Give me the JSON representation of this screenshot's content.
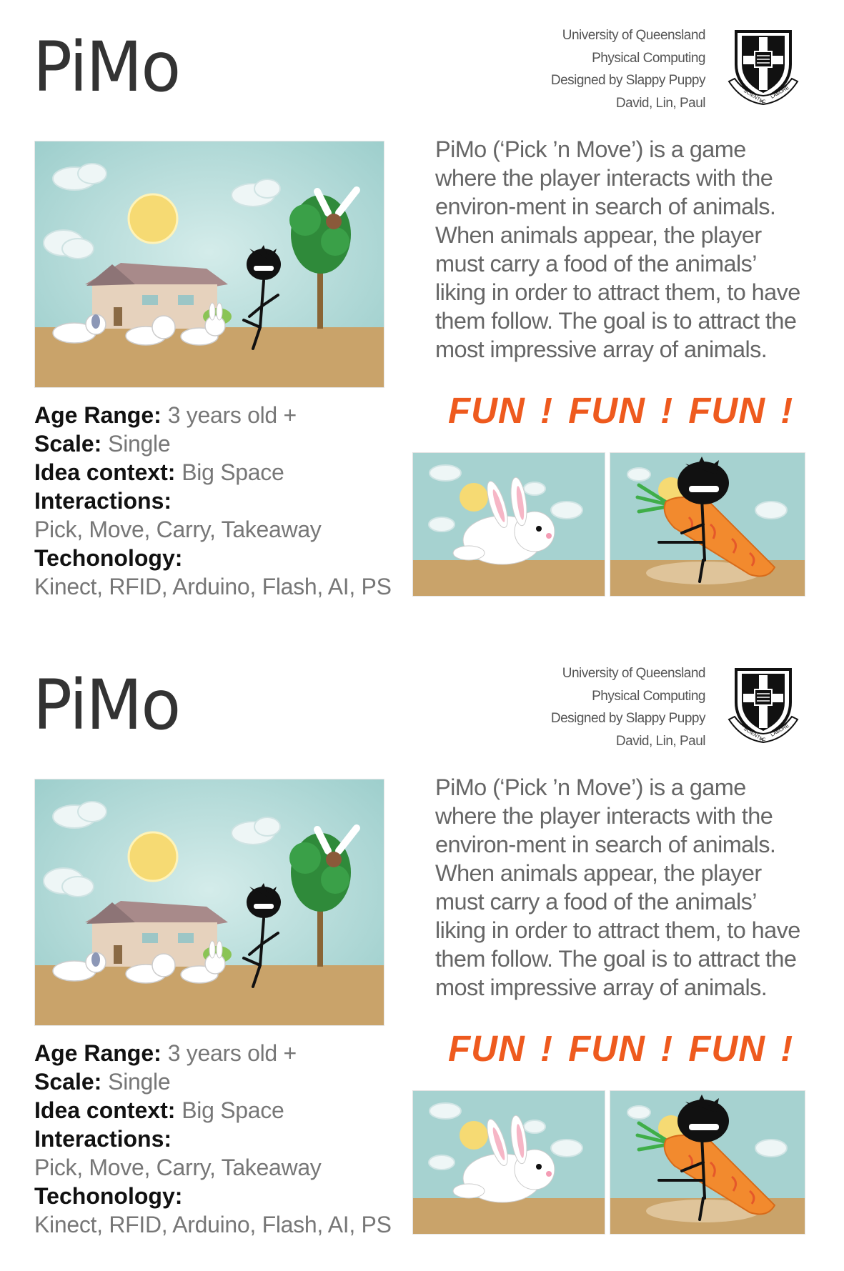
{
  "panels": [
    {
      "title": "PiMo",
      "credits": [
        "University of Queensland",
        "Physical Computing",
        "Designed by Slappy Puppy",
        "David, Lin, Paul"
      ],
      "crest": {
        "motto_left": "SCIENTIA",
        "motto_right": "LABORE",
        "motto_bottom": "AC"
      },
      "description": "PiMo (‘Pick ’n Move’) is a game where the player interacts with the environ-ment in search of animals. When animals appear, the player must carry a food of the animals’ liking in order to attract them, to have them follow.  The goal is to attract the most impressive array of animals.",
      "fun": "FUN !  FUN !  FUN !",
      "info": {
        "age_label": "Age Range:",
        "age_value": "3 years old +",
        "scale_label": "Scale:",
        "scale_value": "Single",
        "context_label": "Idea context:",
        "context_value": "Big Space",
        "interactions_label": "Interactions:",
        "interactions_value": "Pick, Move, Carry, Takeaway",
        "technology_label": "Techonology:",
        "technology_value": "Kinect, RFID, Arduino, Flash, AI, PS"
      }
    },
    {
      "title": "PiMo",
      "credits": [
        "University of Queensland",
        "Physical Computing",
        "Designed by Slappy Puppy",
        "David, Lin, Paul"
      ],
      "crest": {
        "motto_left": "SCIENTIA",
        "motto_right": "LABORE",
        "motto_bottom": "AC"
      },
      "description": "PiMo (‘Pick ’n Move’) is a game where the player interacts with the environ-ment in search of animals. When animals appear, the player must carry a food of the animals’ liking in order to attract them, to have them follow.  The goal is to attract the most impressive array of animals.",
      "fun": "FUN !  FUN !  FUN !",
      "info": {
        "age_label": "Age Range:",
        "age_value": "3 years old +",
        "scale_label": "Scale:",
        "scale_value": "Single",
        "context_label": "Idea context:",
        "context_value": "Big Space",
        "interactions_label": "Interactions:",
        "interactions_value": "Pick, Move, Carry, Takeaway",
        "technology_label": "Techonology:",
        "technology_value": "Kinect, RFID, Arduino, Flash, AI, PS"
      }
    }
  ],
  "colors": {
    "sky": "#a9d4d2",
    "ground": "#c9a36a",
    "sun": "#f5d972",
    "fun_text": "#ee5a1e",
    "carrot": "#f28a2e",
    "leaf": "#3fae49",
    "tree": "#2f8a3a"
  }
}
